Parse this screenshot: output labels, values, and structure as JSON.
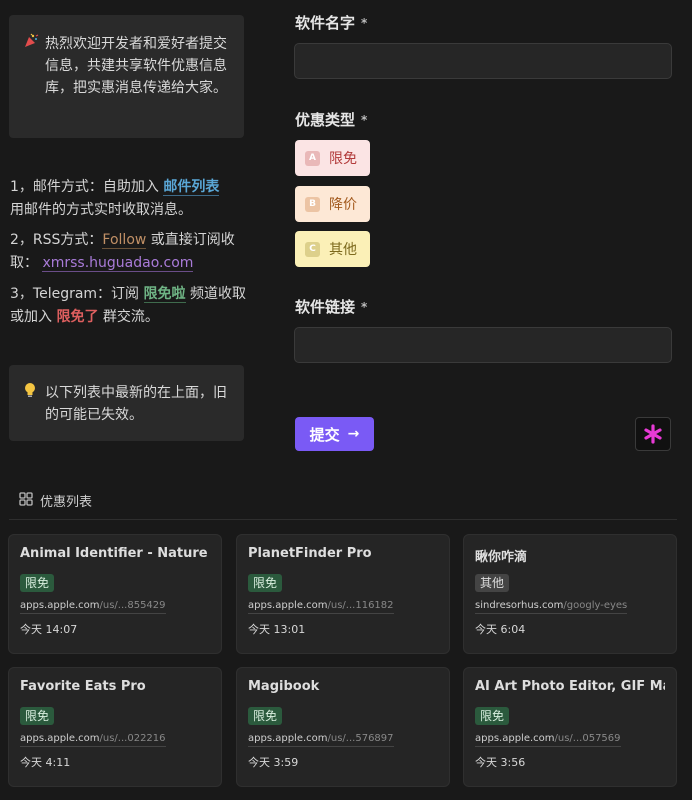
{
  "callout_top": {
    "icon": "party-popper-icon",
    "text": "热烈欢迎开发者和爱好者提交信息，共建共享软件优惠信息库，把实惠消息传递给大家。"
  },
  "info": {
    "mail": {
      "prefix": "1，邮件方式：自助加入 ",
      "link": "邮件列表",
      "suffix": "用邮件的方式实时收取消息。"
    },
    "rss": {
      "prefix": "2，RSS方式：",
      "link1": "Follow",
      "middle": " 或直接订阅收取：",
      "link2": "xmrss.huguadao.com"
    },
    "telegram": {
      "prefix": "3，Telegram：订阅 ",
      "link1": "限免啦",
      "middle": " 频道收取或加入 ",
      "link2": "限免了",
      "suffix": " 群交流。"
    }
  },
  "callout_bottom": {
    "icon": "lightbulb-icon",
    "text": "以下列表中最新的在上面，旧的可能已失效。"
  },
  "form": {
    "name_label": "软件名字",
    "type_label": "优惠类型",
    "link_label": "软件链接",
    "required_mark": "*",
    "name_value": "",
    "link_value": "",
    "options": [
      {
        "key": "A",
        "label": "限免",
        "color": "#fbe4e4"
      },
      {
        "key": "B",
        "label": "降价",
        "color": "#fde8d6"
      },
      {
        "key": "C",
        "label": "其他",
        "color": "#fbf0b7"
      }
    ],
    "submit_label": "提交",
    "accent": "#7a5af5",
    "star_color": "#e83ad6"
  },
  "list": {
    "title": "优惠列表",
    "cards": [
      {
        "title": "Animal Identifier - Nature ID",
        "tag": "限免",
        "url_host": "apps.apple.com",
        "url_rest": "/us/...855429",
        "time": "今天 14:07"
      },
      {
        "title": "PlanetFinder Pro",
        "tag": "限免",
        "url_host": "apps.apple.com",
        "url_rest": "/us/...116182",
        "time": "今天 13:01"
      },
      {
        "title": "瞅你咋滴",
        "tag": "其他",
        "url_host": "sindresorhus.com",
        "url_rest": "/googly-eyes",
        "time": "今天 6:04"
      },
      {
        "title": "Favorite Eats Pro",
        "tag": "限免",
        "url_host": "apps.apple.com",
        "url_rest": "/us/...022216",
        "time": "今天 4:11"
      },
      {
        "title": "Magibook",
        "tag": "限免",
        "url_host": "apps.apple.com",
        "url_rest": "/us/...576897",
        "time": "今天 3:59"
      },
      {
        "title": "AI Art Photo Editor, GIF Maker",
        "tag": "限免",
        "url_host": "apps.apple.com",
        "url_rest": "/us/...057569",
        "time": "今天 3:56"
      }
    ]
  }
}
